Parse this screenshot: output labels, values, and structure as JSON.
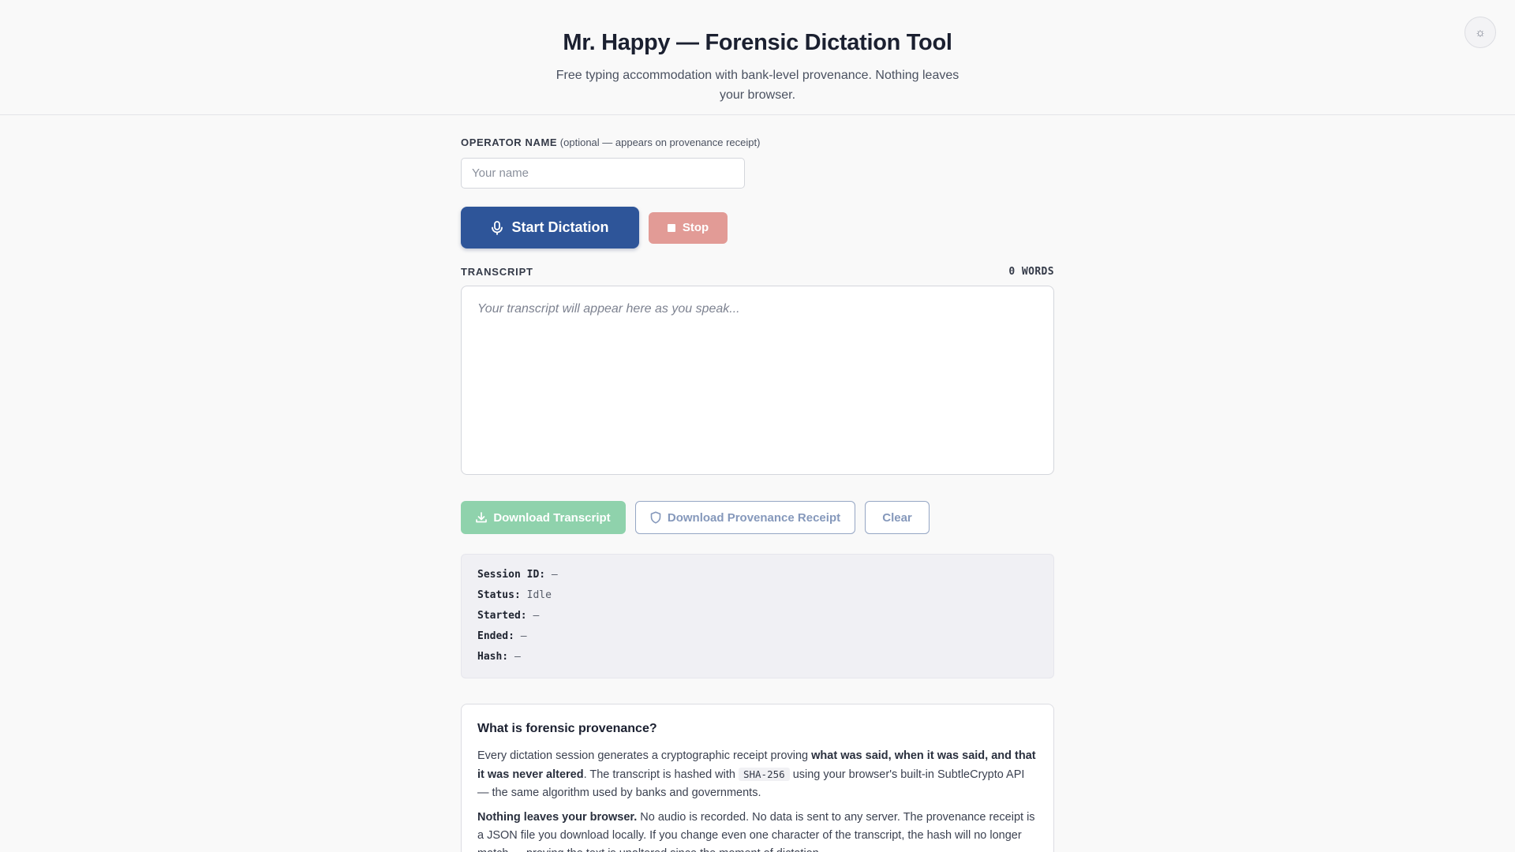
{
  "header": {
    "title": "Mr. Happy — Forensic Dictation Tool",
    "subtitle": "Free typing accommodation with bank-level provenance. Nothing leaves your browser.",
    "theme_icon": "☼"
  },
  "operator": {
    "label": "OPERATOR NAME",
    "hint": "(optional — appears on provenance receipt)",
    "placeholder": "Your name",
    "value": ""
  },
  "controls": {
    "start_label": "Start Dictation",
    "stop_label": "Stop"
  },
  "transcript": {
    "label": "TRANSCRIPT",
    "word_count": "0 WORDS",
    "placeholder": "Your transcript will appear here as you speak..."
  },
  "actions": {
    "download_transcript": "Download Transcript",
    "download_receipt": "Download Provenance Receipt",
    "clear": "Clear"
  },
  "session": {
    "id_label": "Session ID:",
    "id_value": "—",
    "status_label": "Status:",
    "status_value": "Idle",
    "started_label": "Started:",
    "started_value": "—",
    "ended_label": "Ended:",
    "ended_value": "—",
    "hash_label": "Hash:",
    "hash_value": "—"
  },
  "info": {
    "heading": "What is forensic provenance?",
    "p1_a": "Every dictation session generates a cryptographic receipt proving ",
    "p1_b": "what was said, when it was said, and that it was never altered",
    "p1_c": ". The transcript is hashed with ",
    "p1_code": "SHA-256",
    "p1_d": " using your browser's built-in SubtleCrypto API — the same algorithm used by banks and governments.",
    "p2_a": "Nothing leaves your browser.",
    "p2_b": " No audio is recorded. No data is sent to any server. The provenance receipt is a JSON file you download locally. If you change even one character of the transcript, the hash will no longer match — proving the text is unaltered since the moment of dictation."
  },
  "colors": {
    "primary": "#2e5599",
    "stop": "#e29b96",
    "download": "#8fd2ac",
    "outline": "#95a6c4"
  }
}
